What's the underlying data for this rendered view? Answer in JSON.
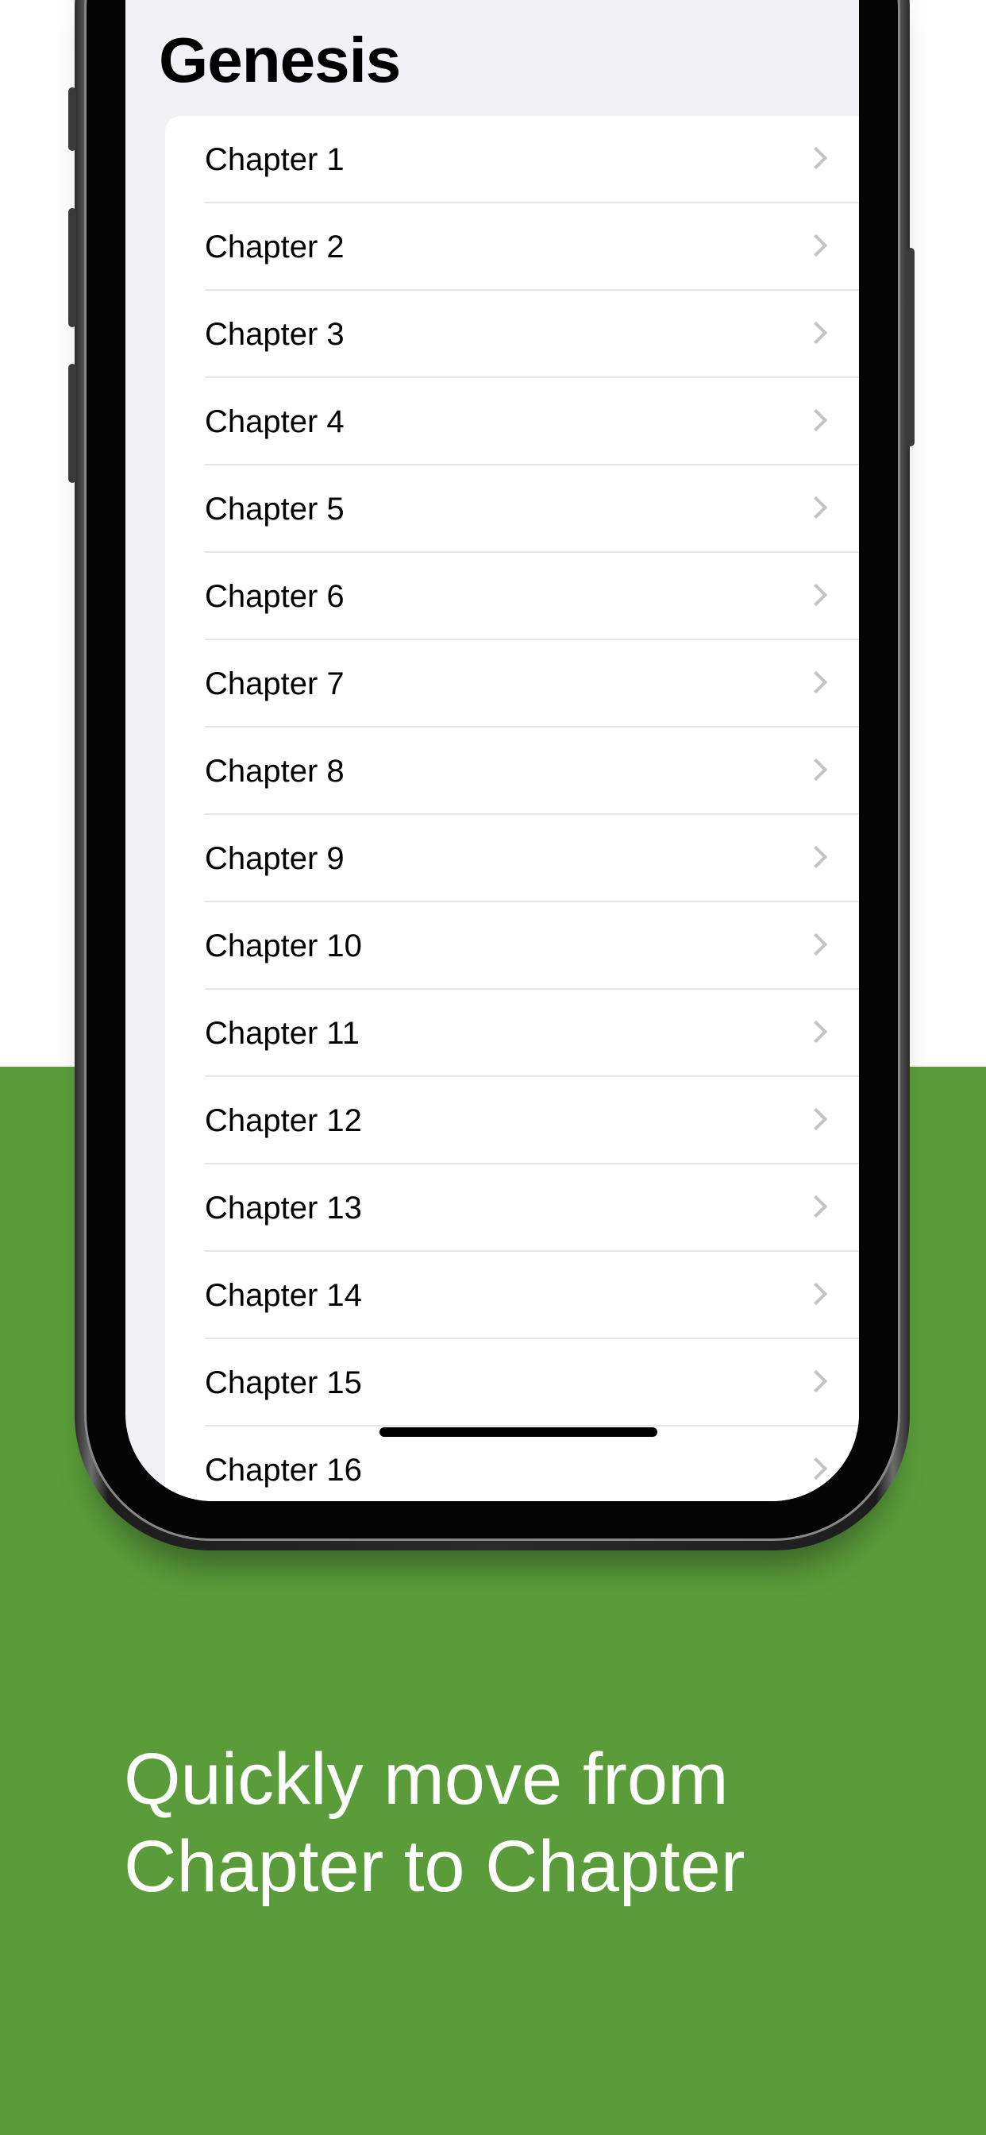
{
  "colors": {
    "background_top": "#ffffff",
    "background_bottom": "#5a9c3a",
    "caption_text": "#ffffff",
    "chevron": "#c2c2c7"
  },
  "screen": {
    "title": "Genesis",
    "chapters": [
      "Chapter 1",
      "Chapter 2",
      "Chapter 3",
      "Chapter 4",
      "Chapter 5",
      "Chapter 6",
      "Chapter 7",
      "Chapter 8",
      "Chapter 9",
      "Chapter 10",
      "Chapter 11",
      "Chapter 12",
      "Chapter 13",
      "Chapter 14",
      "Chapter 15",
      "Chapter 16"
    ],
    "row_icon": "chevron-right-icon"
  },
  "caption": {
    "line1": "Quickly move from",
    "line2": "Chapter to Chapter"
  }
}
